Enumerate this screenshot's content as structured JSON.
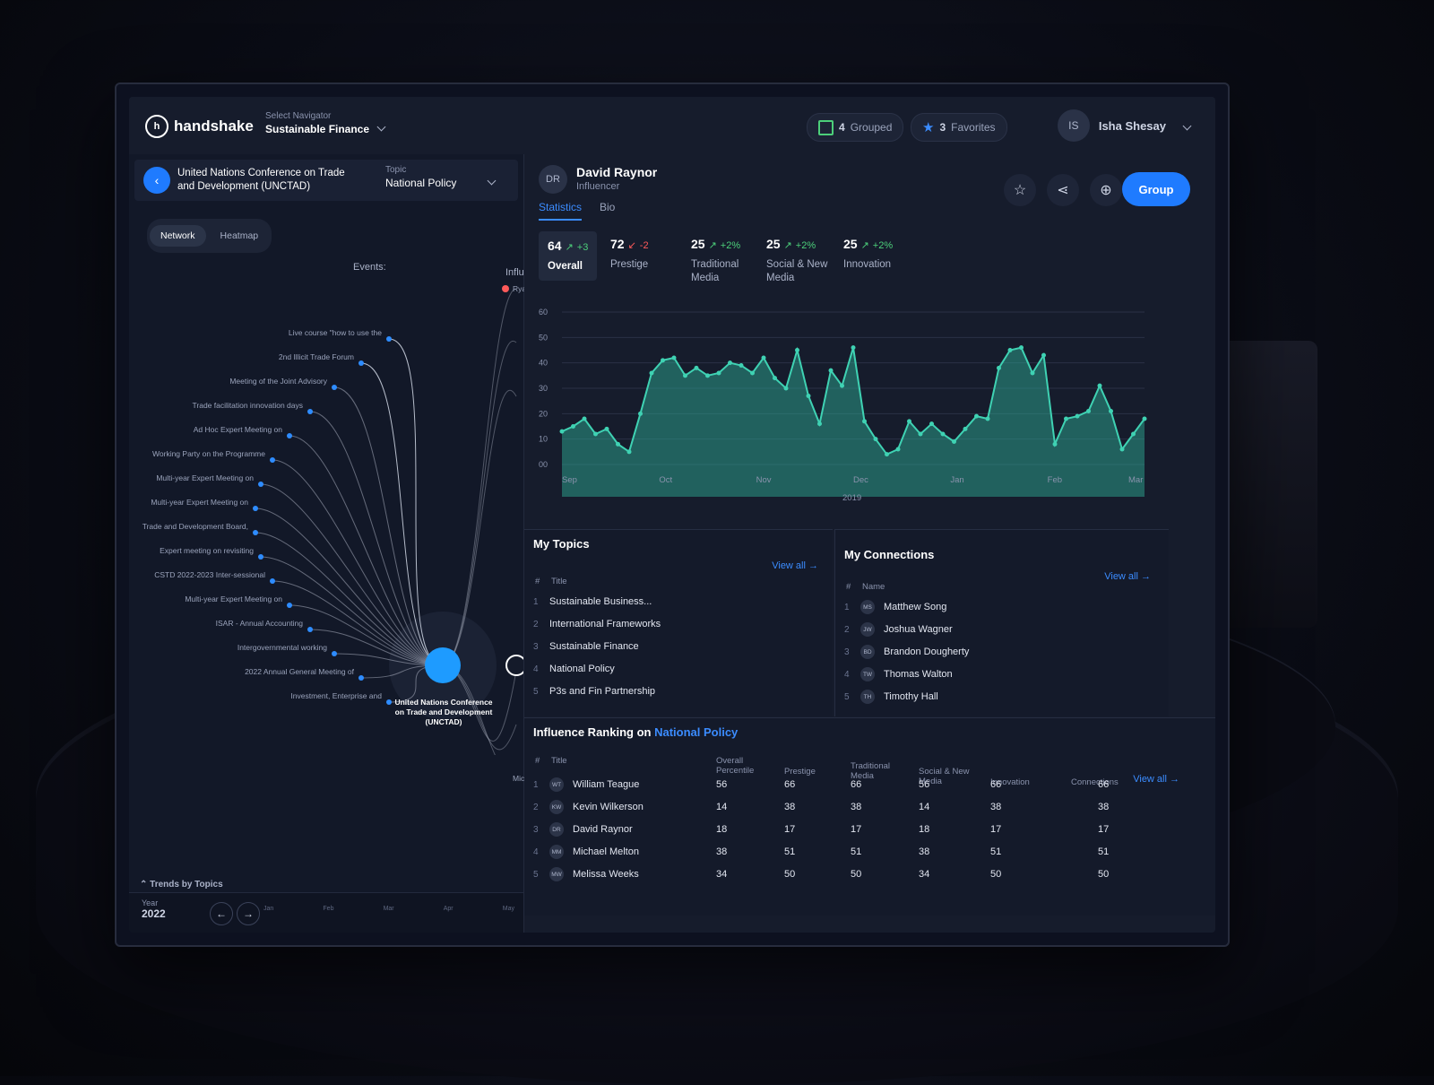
{
  "brand": {
    "name": "handshake",
    "logo_glyph": "h"
  },
  "navigator": {
    "label": "Select Navigator",
    "value": "Sustainable Finance"
  },
  "header": {
    "grouped_count": "4",
    "grouped_label": "Grouped",
    "favorites_count": "3",
    "favorites_label": "Favorites",
    "user_initials": "IS",
    "user_name": "Isha Shesay"
  },
  "org": {
    "name": "United Nations Conference on Trade and Development (UNCTAD)"
  },
  "topic_select": {
    "label": "Topic",
    "value": "National Policy"
  },
  "view_toggle": {
    "network": "Network",
    "heatmap": "Heatmap"
  },
  "network": {
    "events_label": "Events:",
    "influencers_label": "Influ",
    "hub_label": "United Nations Conference on Trade and Development (UNCTAD)",
    "events": [
      "Live course \"how to use the",
      "2nd Illicit Trade Forum",
      "Meeting of the Joint Advisory",
      "Trade facilitation innovation days",
      "Ad Hoc Expert Meeting on",
      "Working Party on the Programme",
      "Multi-year Expert Meeting on",
      "Multi-year Expert Meeting on",
      "Trade and Development Board,",
      "Expert meeting on revisiting",
      "CSTD 2022-2023 Inter-sessional",
      "Multi-year Expert Meeting on",
      "ISAR - Annual Accounting",
      "Intergovernmental working",
      "2022 Annual General Meeting of",
      "Investment, Enterprise and"
    ],
    "influencers": [
      "Ryan",
      "Mich"
    ]
  },
  "trends": {
    "label": "Trends by Topics",
    "year_label": "Year",
    "year": "2022",
    "months": [
      "Jan",
      "Feb",
      "Mar",
      "Apr",
      "May"
    ]
  },
  "profile": {
    "initials": "DR",
    "name": "David Raynor",
    "role": "Influencer",
    "group_button": "Group"
  },
  "tabs": {
    "statistics": "Statistics",
    "bio": "Bio"
  },
  "stats": [
    {
      "value": "64",
      "delta": "+3",
      "direction": "up",
      "label": "Overall"
    },
    {
      "value": "72",
      "delta": "-2",
      "direction": "down",
      "label": "Prestige"
    },
    {
      "value": "25",
      "delta": "+2%",
      "direction": "up",
      "label": "Traditional Media"
    },
    {
      "value": "25",
      "delta": "+2%",
      "direction": "up",
      "label": "Social & New Media"
    },
    {
      "value": "25",
      "delta": "+2%",
      "direction": "up",
      "label": "Innovation"
    }
  ],
  "chart_data": {
    "type": "area",
    "y_ticks": [
      "60",
      "50",
      "40",
      "30",
      "20",
      "10",
      "00"
    ],
    "ylim": [
      0,
      60
    ],
    "x_labels": [
      "Sep",
      "Oct",
      "Nov",
      "Dec",
      "Jan",
      "Feb",
      "Mar"
    ],
    "year_label": "2019",
    "values": [
      13,
      15,
      18,
      12,
      14,
      8,
      5,
      20,
      36,
      41,
      42,
      35,
      38,
      35,
      36,
      40,
      39,
      36,
      42,
      34,
      30,
      45,
      27,
      16,
      37,
      31,
      46,
      17,
      10,
      4,
      6,
      17,
      12,
      16,
      12,
      9,
      14,
      19,
      18,
      38,
      45,
      46,
      36,
      43,
      8,
      18,
      19,
      21,
      31,
      21,
      6,
      12,
      18
    ],
    "color": "#2fb59c"
  },
  "my_topics": {
    "title": "My Topics",
    "view_all": "View all →",
    "col_num": "#",
    "col_title": "Title",
    "items": [
      "Sustainable Business...",
      "International Frameworks",
      "Sustainable Finance",
      "National Policy",
      "P3s and Fin Partnership"
    ]
  },
  "my_connections": {
    "title": "My Connections",
    "view_all": "View all →",
    "col_num": "#",
    "col_name": "Name",
    "items": [
      {
        "initials": "MS",
        "name": "Matthew Song"
      },
      {
        "initials": "JW",
        "name": "Joshua Wagner"
      },
      {
        "initials": "BD",
        "name": "Brandon Dougherty"
      },
      {
        "initials": "TW",
        "name": "Thomas Walton"
      },
      {
        "initials": "TH",
        "name": "Timothy Hall"
      }
    ]
  },
  "ranking": {
    "title_prefix": "Influence Ranking on",
    "title_topic": "National Policy",
    "view_all": "View all →",
    "columns": [
      "#",
      "Title",
      "Overall Percentile",
      "Prestige",
      "Traditional Media",
      "Social & New Media",
      "Innovation",
      "Connections"
    ],
    "rows": [
      {
        "initials": "WT",
        "name": "William Teague",
        "overall": "56",
        "prestige": "66",
        "traditional": "66",
        "social": "56",
        "innovation": "66",
        "connections": "66"
      },
      {
        "initials": "KW",
        "name": "Kevin Wilkerson",
        "overall": "14",
        "prestige": "38",
        "traditional": "38",
        "social": "14",
        "innovation": "38",
        "connections": "38"
      },
      {
        "initials": "DR",
        "name": "David Raynor",
        "overall": "18",
        "prestige": "17",
        "traditional": "17",
        "social": "18",
        "innovation": "17",
        "connections": "17"
      },
      {
        "initials": "MM",
        "name": "Michael Melton",
        "overall": "38",
        "prestige": "51",
        "traditional": "51",
        "social": "38",
        "innovation": "51",
        "connections": "51"
      },
      {
        "initials": "MW",
        "name": "Melissa Weeks",
        "overall": "34",
        "prestige": "50",
        "traditional": "50",
        "social": "34",
        "innovation": "50",
        "connections": "50"
      }
    ]
  }
}
